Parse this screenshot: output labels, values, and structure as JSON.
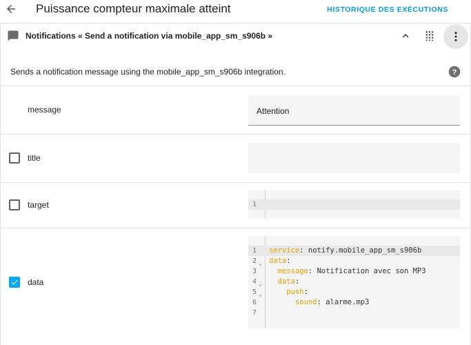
{
  "header": {
    "title": "Puissance compteur maximale atteint",
    "history_label": "HISTORIQUE DES EXÉCUTIONS"
  },
  "card": {
    "title": "Notifications « Send a notification via mobile_app_sm_s906b »",
    "description": "Sends a notification message using the mobile_app_sm_s906b integration."
  },
  "fields": {
    "message": {
      "label": "message",
      "value": "Attention"
    },
    "title": {
      "label": "title",
      "value": "",
      "checked": false
    },
    "target": {
      "label": "target",
      "checked": false,
      "line_numbers": [
        "1"
      ]
    },
    "data": {
      "label": "data",
      "checked": true,
      "line_numbers": [
        "1",
        "2",
        "3",
        "4",
        "5",
        "6",
        "7"
      ],
      "lines": [
        {
          "key": "service",
          "value": " notify.mobile_app_sm_s906b",
          "indent": ""
        },
        {
          "key": "data",
          "value": "",
          "indent": ""
        },
        {
          "key": "message",
          "value": " Notification avec son MP3",
          "indent": "  "
        },
        {
          "key": "data",
          "value": "",
          "indent": "  "
        },
        {
          "key": "push",
          "value": "",
          "indent": "    "
        },
        {
          "key": "sound",
          "value": " alarme.mp3",
          "indent": "      "
        },
        {
          "key": "",
          "value": "",
          "indent": ""
        }
      ]
    }
  },
  "colors": {
    "accent": "#03a9f4",
    "link": "#039be5",
    "yaml_key": "#e6a100"
  },
  "icons": {
    "back": "arrow-left-icon",
    "message": "message-icon",
    "collapse": "chevron-up-icon",
    "grid": "grid-icon",
    "more": "dots-vertical-icon",
    "help": "help-circle-icon",
    "check": "check-icon",
    "fold": "fold-chevron-icon"
  }
}
